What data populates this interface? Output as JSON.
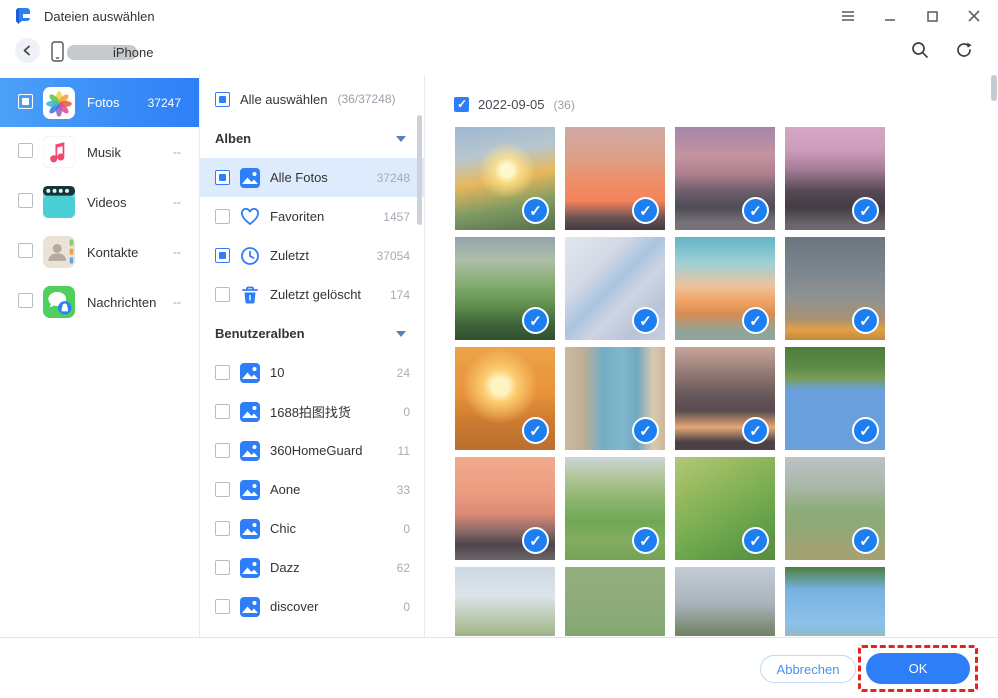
{
  "titlebar": {
    "title": "Dateien auswählen"
  },
  "navbar": {
    "device_name_suffix": "iPhone"
  },
  "sidebar": {
    "items": [
      {
        "label": "Fotos",
        "count": "37247",
        "icon": "photos-app-icon",
        "selected": true,
        "checkbox": "white-ind"
      },
      {
        "label": "Musik",
        "count": "--",
        "icon": "music-app-icon",
        "selected": false,
        "checkbox": "unchecked"
      },
      {
        "label": "Videos",
        "count": "--",
        "icon": "videos-app-icon",
        "selected": false,
        "checkbox": "unchecked"
      },
      {
        "label": "Kontakte",
        "count": "--",
        "icon": "contacts-app-icon",
        "selected": false,
        "checkbox": "unchecked"
      },
      {
        "label": "Nachrichten",
        "count": "--",
        "icon": "messages-app-icon",
        "selected": false,
        "checkbox": "unchecked"
      }
    ]
  },
  "albums_panel": {
    "select_all_label": "Alle auswählen",
    "select_all_count": "(36/37248)",
    "sections": [
      {
        "title": "Alben",
        "items": [
          {
            "label": "Alle Fotos",
            "count": "37248",
            "icon": "album-icon",
            "checkbox": "ind",
            "selected": true
          },
          {
            "label": "Favoriten",
            "count": "1457",
            "icon": "heart-icon",
            "checkbox": "unchecked",
            "selected": false
          },
          {
            "label": "Zuletzt",
            "count": "37054",
            "icon": "clock-icon",
            "checkbox": "ind",
            "selected": false
          },
          {
            "label": "Zuletzt gelöscht",
            "count": "174",
            "icon": "trash-icon",
            "checkbox": "unchecked",
            "selected": false
          }
        ]
      },
      {
        "title": "Benutzeralben",
        "items": [
          {
            "label": "10",
            "count": "24",
            "icon": "album-icon",
            "checkbox": "unchecked",
            "selected": false
          },
          {
            "label": "1688拍图找货",
            "count": "0",
            "icon": "album-icon",
            "checkbox": "unchecked",
            "selected": false
          },
          {
            "label": "360HomeGuard",
            "count": "11",
            "icon": "album-icon",
            "checkbox": "unchecked",
            "selected": false
          },
          {
            "label": "Aone",
            "count": "33",
            "icon": "album-icon",
            "checkbox": "unchecked",
            "selected": false
          },
          {
            "label": "Chic",
            "count": "0",
            "icon": "album-icon",
            "checkbox": "unchecked",
            "selected": false
          },
          {
            "label": "Dazz",
            "count": "62",
            "icon": "album-icon",
            "checkbox": "unchecked",
            "selected": false
          },
          {
            "label": "discover",
            "count": "0",
            "icon": "album-icon",
            "checkbox": "unchecked",
            "selected": false
          }
        ]
      }
    ]
  },
  "gallery": {
    "date_label": "2022-09-05",
    "date_count": "(36)",
    "photos": [
      {
        "name": "sunset-wind-turbines",
        "checked": true,
        "bg": "radial-gradient(circle at 52% 42%, #fff7d0 0 8%, rgba(255,228,140,0.8) 16%, rgba(255,220,120,0) 36%), linear-gradient(170deg, #9db8d0 0%, #b8c6cf 28%, #e8b85c 50%, #7e9a62 75%, #55704a 100%)"
      },
      {
        "name": "orange-sunset-skyline",
        "checked": true,
        "bg": "linear-gradient(180deg, #cfa9a4 0%, #dda088 30%, #ef8e64 55%, #f4825a 72%, #6b5356 88%, #433c42 100%)"
      },
      {
        "name": "purple-dusk-bridge",
        "checked": true,
        "bg": "linear-gradient(180deg, #a586a8 0%, #c493a0 28%, #b07f8e 45%, #6e5f6d 62%, #4e4c55 78%, #767078 92%)"
      },
      {
        "name": "pink-sky-hedge-path",
        "checked": true,
        "bg": "linear-gradient(180deg, #d6a6c6 0%, #cc9cba 22%, #a87f9a 40%, #564a55 62%, #423c44 78%, #6e666c 95%)"
      },
      {
        "name": "green-valley-hills",
        "checked": true,
        "bg": "linear-gradient(180deg, #93a3ac 0%, #aebfa8 22%, #86ad72 45%, #61924f 65%, #3f6339 85%, #2f4f2e 100%)"
      },
      {
        "name": "braided-river-sand",
        "checked": true,
        "bg": "linear-gradient(135deg, #e3e6ee 0%, #d3d9e6 30%, #aac4e0 48%, #cdd4e2 62%, #b9c3d8 82%, #c9cfdd 100%)"
      },
      {
        "name": "ocean-sunset-clouds",
        "checked": true,
        "bg": "linear-gradient(180deg, #62b4c4 0%, #9fd0d6 25%, #edc29a 48%, #f2a465 62%, #d68c52 75%, #8fa49b 92%)"
      },
      {
        "name": "blurry-sea-sun-reflection",
        "checked": true,
        "bg": "linear-gradient(180deg, #6b7680 0%, #7d878f 35%, #90938f 60%, #a89272 80%, #e3a047 90%, #c08a3c 100%)"
      },
      {
        "name": "golden-sun-over-waves",
        "checked": true,
        "bg": "radial-gradient(circle at 45% 38%, #fff3c4 0 10%, rgba(255,214,120,0.85) 20%, rgba(240,150,60,0) 45%), linear-gradient(180deg, #eda349 0%, #e8923a 45%, #cf7c30 70%, #b96f2e 100%)"
      },
      {
        "name": "beach-alley-palm",
        "checked": true,
        "bg": "linear-gradient(90deg, #cbbba2 0%, #bfae94 18%, #74aec6 38%, #81b7cc 58%, #6fa8c0 72%, #d9c9ae 88%, #cbb89c 100%)"
      },
      {
        "name": "dark-clouds-palm-sunset",
        "checked": true,
        "bg": "linear-gradient(180deg, #c9a49a 0%, #8d7570 28%, #655659 48%, #584b50 62%, #e5a876 78%, #4c4245 92%)"
      },
      {
        "name": "inverted-trees-blue-sky",
        "checked": true,
        "bg": "linear-gradient(180deg, #4d7c3c 0%, #5d8c48 20%, #769e58 30%, #6b9fdb 42%, #6b9fdb 100%)"
      },
      {
        "name": "pink-clouds-palms",
        "checked": true,
        "bg": "linear-gradient(180deg, #f2ab8d 0%, #eb9b80 35%, #dc8a76 55%, #8c6a68 72%, #4c4549 85%, #6d6569 100%)"
      },
      {
        "name": "rolling-hills-winding-road",
        "checked": true,
        "bg": "linear-gradient(180deg, #ccd5da 0%, #b3c79c 18%, #8fb671 40%, #6fa855 62%, #83ad60 82%, #76a258 100%)"
      },
      {
        "name": "green-hillside-trail",
        "checked": true,
        "bg": "linear-gradient(150deg, #b3c878 0%, #95b95e 28%, #7aad52 52%, #64a048 74%, #578c40 100%)"
      },
      {
        "name": "grassy-hill-signpost",
        "checked": true,
        "bg": "linear-gradient(180deg, #bcc2c6 0%, #aab8a8 28%, #8cab7a 52%, #90a878 72%, #a3a272 90%)"
      },
      {
        "name": "hill-under-cloudy-sky",
        "checked": true,
        "bg": "linear-gradient(180deg, #ccd8e2 0%, #dce4ea 28%, #aebf9a 58%, #8aa474 78%, #7a9a66 100%)"
      },
      {
        "name": "pasture-with-cows",
        "checked": true,
        "bg": "linear-gradient(180deg, #94af7f 0%, #8cab78 40%, #84a572 70%, #7da06c 100%)"
      },
      {
        "name": "misty-mountain-ridge",
        "checked": true,
        "bg": "linear-gradient(180deg, #c3ccd4 0%, #aab4bc 35%, #79896f 62%, #55754c 82%, #486847 100%)"
      },
      {
        "name": "tree-branches-blue-sky",
        "checked": true,
        "bg": "linear-gradient(180deg, #4e7e3e 0%, #78b2e2 22%, #8cc0ea 55%, #9cb47e 88%, #87a468 100%)"
      }
    ]
  },
  "footer": {
    "cancel_label": "Abbrechen",
    "ok_label": "OK"
  },
  "colors": {
    "accent": "#2e7ef7",
    "badge_blue": "#1c7ef0",
    "highlight_red": "#e8221f",
    "selected_row_bg": "#ddebfc",
    "sidebar_gradient_start": "#4ba1f8",
    "sidebar_gradient_end": "#2e7ef7"
  }
}
